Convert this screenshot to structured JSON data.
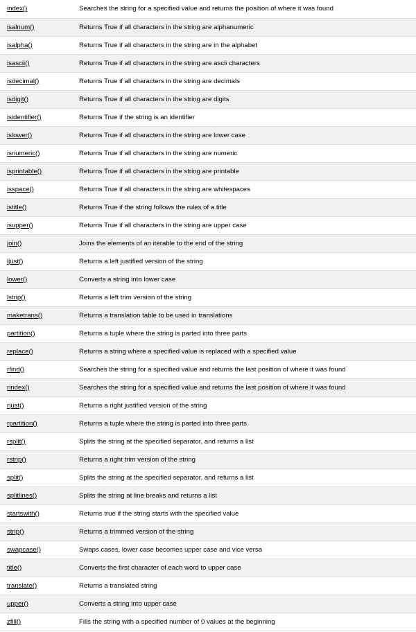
{
  "methods": [
    {
      "name": "index()",
      "description": "Searches the string for a specified value and returns the position of where it was found"
    },
    {
      "name": "isalnum()",
      "description": "Returns True if all characters in the string are alphanumeric"
    },
    {
      "name": "isalpha()",
      "description": "Returns True if all characters in the string are in the alphabet"
    },
    {
      "name": "isascii()",
      "description": "Returns True if all characters in the string are ascii characters"
    },
    {
      "name": "isdecimal()",
      "description": "Returns True if all characters in the string are decimals"
    },
    {
      "name": "isdigit()",
      "description": "Returns True if all characters in the string are digits"
    },
    {
      "name": "isidentifier()",
      "description": "Returns True if the string is an identifier"
    },
    {
      "name": "islower()",
      "description": "Returns True if all characters in the string are lower case"
    },
    {
      "name": "isnumeric()",
      "description": "Returns True if all characters in the string are numeric"
    },
    {
      "name": "isprintable()",
      "description": "Returns True if all characters in the string are printable"
    },
    {
      "name": "isspace()",
      "description": "Returns True if all characters in the string are whitespaces"
    },
    {
      "name": "istitle()",
      "description": "Returns True if the string follows the rules of a title"
    },
    {
      "name": "isupper()",
      "description": "Returns True if all characters in the string are upper case"
    },
    {
      "name": "join()",
      "description": "Joins the elements of an iterable to the end of the string"
    },
    {
      "name": "ljust()",
      "description": "Returns a left justified version of the string"
    },
    {
      "name": "lower()",
      "description": "Converts a string into lower case"
    },
    {
      "name": "lstrip()",
      "description": "Returns a left trim version of the string"
    },
    {
      "name": "maketrans()",
      "description": "Returns a translation table to be used in translations"
    },
    {
      "name": "partition()",
      "description": "Returns a tuple where the string is parted into three parts"
    },
    {
      "name": "replace()",
      "description": "Returns a string where a specified value is replaced with a specified value"
    },
    {
      "name": "rfind()",
      "description": "Searches the string for a specified value and returns the last position of where it was found"
    },
    {
      "name": "rindex()",
      "description": "Searches the string for a specified value and returns the last position of where it was found"
    },
    {
      "name": "rjust()",
      "description": "Returns a right justified version of the string"
    },
    {
      "name": "rpartition()",
      "description": "Returns a tuple where the string is parted into three parts"
    },
    {
      "name": "rsplit()",
      "description": "Splits the string at the specified separator, and returns a list"
    },
    {
      "name": "rstrip()",
      "description": "Returns a right trim version of the string"
    },
    {
      "name": "split()",
      "description": "Splits the string at the specified separator, and returns a list"
    },
    {
      "name": "splitlines()",
      "description": "Splits the string at line breaks and returns a list"
    },
    {
      "name": "startswith()",
      "description": "Returns true if the string starts with the specified value"
    },
    {
      "name": "strip()",
      "description": "Returns a trimmed version of the string"
    },
    {
      "name": "swapcase()",
      "description": "Swaps cases, lower case becomes upper case and vice versa"
    },
    {
      "name": "title()",
      "description": "Converts the first character of each word to upper case"
    },
    {
      "name": "translate()",
      "description": "Returns a translated string"
    },
    {
      "name": "upper()",
      "description": "Converts a string into upper case"
    },
    {
      "name": "zfill()",
      "description": "Fills the string with a specified number of 0 values at the beginning"
    }
  ]
}
